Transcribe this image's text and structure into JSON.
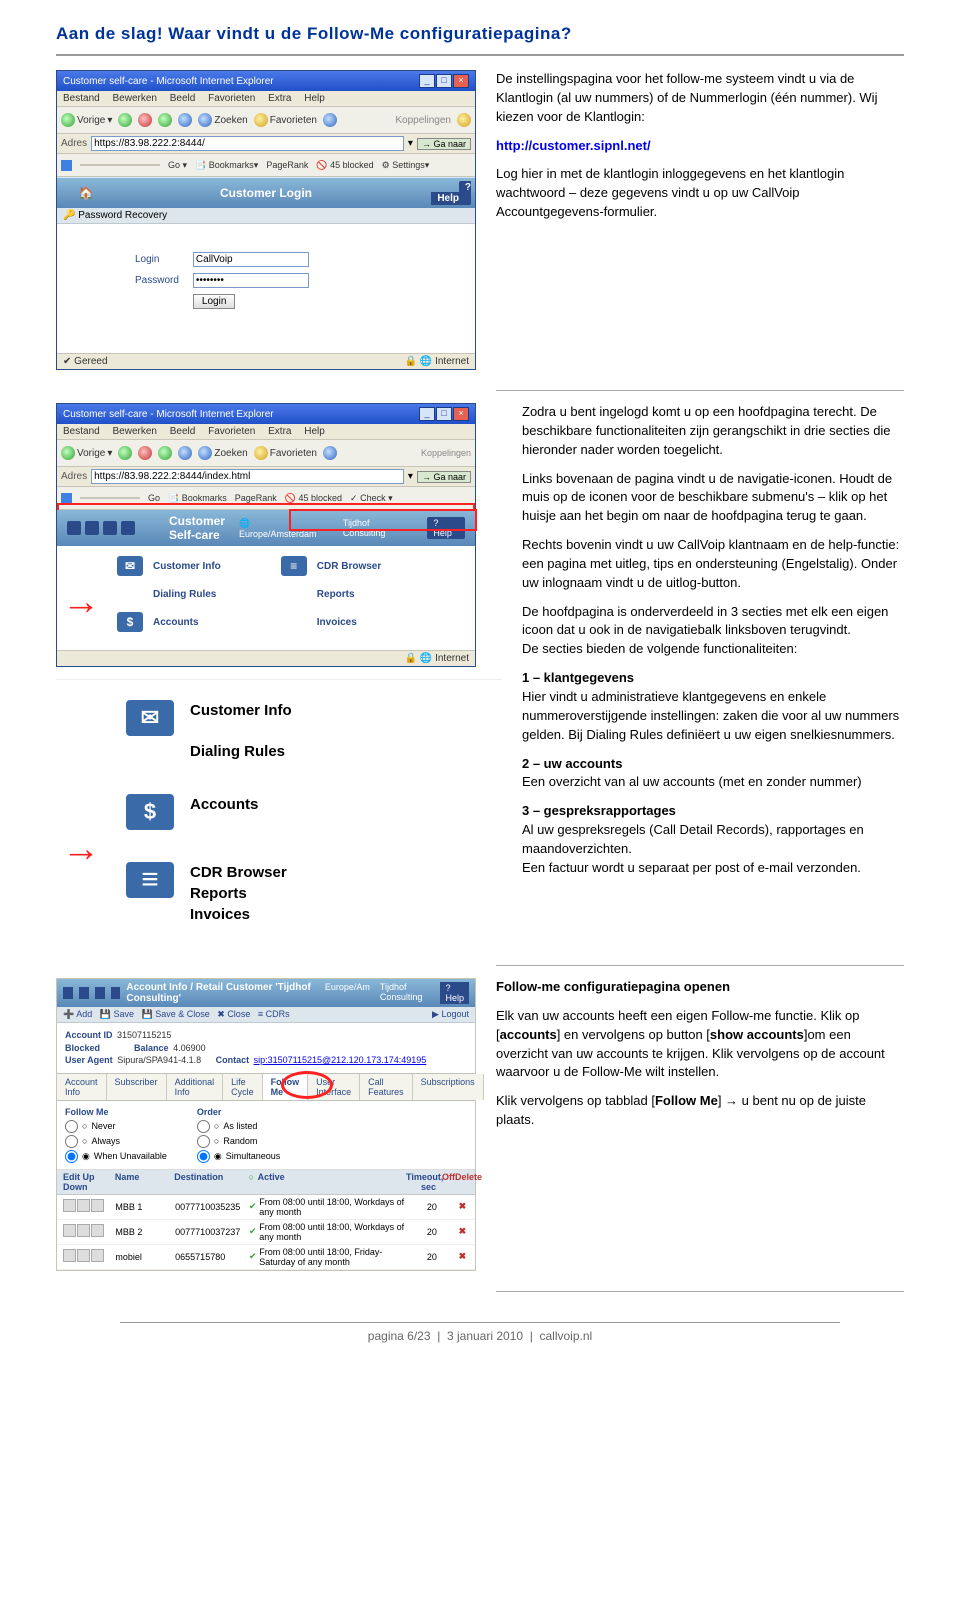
{
  "title": "Aan de slag! Waar vindt u de Follow-Me configuratiepagina?",
  "intro": {
    "p1": "De instellingspagina voor het follow-me systeem vindt u via de Klantlogin (al uw nummers) of de Nummerlogin (één nummer). Wij kiezen voor de Klantlogin:",
    "url": "http://customer.sipnl.net/",
    "p2": "Log hier in met de klantlogin inloggegevens en het klantlogin wachtwoord – deze gegevens vindt u op uw CallVoip Accountgegevens-formulier."
  },
  "ie1": {
    "title": "Customer self-care - Microsoft Internet Explorer",
    "menu": [
      "Bestand",
      "Bewerken",
      "Beeld",
      "Favorieten",
      "Extra",
      "Help"
    ],
    "back": "Vorige",
    "search": "Zoeken",
    "fav": "Favorieten",
    "koppelingen": "Koppelingen",
    "addr_label": "Adres",
    "addr": "https://83.98.222.2:8444/",
    "go": "Ga naar",
    "tb2": [
      "Go",
      "Bookmarks",
      "PageRank",
      "45 blocked",
      "Settings"
    ],
    "login_header": "Customer Login",
    "help": "Help",
    "pass_rec": "Password Recovery",
    "login_label": "Login",
    "login_value": "CallVoip",
    "pw_label": "Password",
    "pw_value": "••••••••",
    "login_btn": "Login",
    "status_left": "Gereed",
    "status_right": "Internet"
  },
  "section2": {
    "p1": "Zodra u bent ingelogd komt u op een hoofdpagina terecht. De beschikbare functionaliteiten zijn gerangschikt in drie secties die hieronder nader worden toegelicht.",
    "p2": "Links bovenaan de pagina vindt u de navigatie-iconen. Houdt de muis op de iconen voor de beschikbare submenu's – klik op het huisje aan het begin om naar de hoofdpagina terug te gaan.",
    "p3": "Rechts bovenin vindt u uw CallVoip klantnaam en de help-functie: een pagina met uitleg, tips en ondersteuning (Engelstalig). Onder uw inlognaam vindt u de uitlog-button."
  },
  "ie2": {
    "title": "Customer self-care - Microsoft Internet Explorer",
    "addr": "https://83.98.222.2:8444/index.html",
    "header_title": "Customer Self-care",
    "tab_europe": "Europe/Amsterdam",
    "tab_tijdhof": "Tijdhof Consulting",
    "help": "Help",
    "items_left": [
      "Customer Info",
      "Dialing Rules",
      "Accounts"
    ],
    "items_right": [
      "CDR Browser",
      "Reports",
      "Invoices"
    ],
    "status_right": "Internet"
  },
  "section3": {
    "intro": "De hoofdpagina is onderverdeeld in 3 secties met elk een eigen icoon dat u ook in de navigatiebalk linksboven terugvindt.",
    "intro2": "De secties bieden de volgende functionaliteiten:",
    "h1": "1 – klantgegevens",
    "p1": "Hier vindt u administratieve klantgegevens en enkele nummeroverstijgende instellingen: zaken die voor al uw nummers gelden. Bij Dialing Rules definiëert u uw eigen snelkiesnummers.",
    "h2": "2 – uw accounts",
    "p2": "Een overzicht van al uw accounts (met en zonder nummer)",
    "h3": "3 – gespreksrapportages",
    "p3": "Al uw gespreksregels (Call Detail Records), rapportages en maandoverzichten.",
    "p3b": "Een factuur wordt u separaat per post of e-mail verzonden."
  },
  "ss3": {
    "item1": "Customer Info",
    "item1b": "Dialing Rules",
    "item2": "Accounts",
    "item3a": "CDR Browser",
    "item3b": "Reports",
    "item3c": "Invoices"
  },
  "section4": {
    "h": "Follow-me configuratiepagina openen",
    "p1_a": "Elk van uw accounts heeft een eigen Follow-me functie. Klik op [",
    "p1_accounts": "accounts",
    "p1_b": "] en vervolgens op button [",
    "p1_show": "show accounts",
    "p1_c": "]om een overzicht van uw accounts te krijgen. Klik vervolgens op de account waarvoor u de Follow-Me wilt instellen.",
    "p2_a": "Klik vervolgens op tabblad [",
    "p2_fm": "Follow Me",
    "p2_b": "] → u bent nu op de juiste plaats."
  },
  "ss4": {
    "header": "Account Info / Retail Customer 'Tijdhof Consulting'",
    "right_tabs": [
      "Europe/Am",
      "Tijdhof Consulting",
      "Help"
    ],
    "logout": "Logout",
    "toolbar": [
      "Add",
      "Save",
      "Save & Close",
      "Close",
      "CDRs"
    ],
    "kv": {
      "account_id_k": "Account ID",
      "account_id_v": "31507115215",
      "blocked_k": "Blocked",
      "balance_k": "Balance",
      "balance_v": "4.06900",
      "ua_k": "User Agent",
      "ua_v": "Sipura/SPA941-4.1.8",
      "contact_k": "Contact",
      "contact_v": "sip:31507115215@212.120.173.174:49195"
    },
    "tabs": [
      "Account Info",
      "Subscriber",
      "Additional Info",
      "Life Cycle",
      "Follow Me",
      "User Interface",
      "Call Features",
      "Subscriptions"
    ],
    "fm_label": "Follow Me",
    "fm_opts": [
      "Never",
      "Always",
      "When Unavailable"
    ],
    "order_label": "Order",
    "order_opts": [
      "As listed",
      "Random",
      "Simultaneous"
    ],
    "tbl_hdr": [
      "Edit",
      "Up Down",
      "Name",
      "Destination",
      "Active",
      "Timeout, sec",
      "Off",
      "Delete"
    ],
    "rows": [
      {
        "name": "MBB 1",
        "dest": "0077710035235",
        "active": "From 08:00 until 18:00, Workdays of any month",
        "to": "20"
      },
      {
        "name": "MBB 2",
        "dest": "0077710037237",
        "active": "From 08:00 until 18:00, Workdays of any month",
        "to": "20"
      },
      {
        "name": "mobiel",
        "dest": "0655715780",
        "active": "From 08:00 until 18:00, Friday-Saturday of any month",
        "to": "20"
      }
    ]
  },
  "footer": {
    "page": "pagina 6/23",
    "date": "3 januari 2010",
    "site": "callvoip.nl"
  }
}
